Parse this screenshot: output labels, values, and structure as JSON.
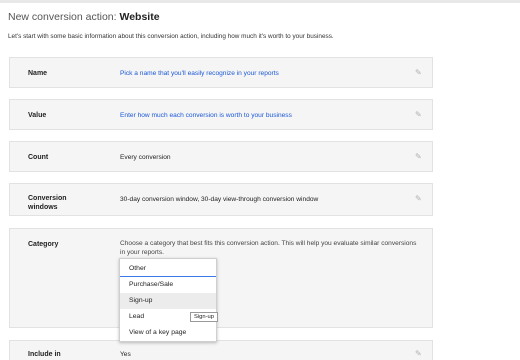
{
  "header": {
    "title_prefix": "New conversion action: ",
    "title_strong": "Website",
    "intro": "Let's start with some basic information about this conversion action, including how much it's worth to your business."
  },
  "rows": {
    "name": {
      "label": "Name",
      "value": "Pick a name that you'll easily recognize in your reports"
    },
    "value": {
      "label": "Value",
      "value": "Enter how much each conversion is worth to your business"
    },
    "count": {
      "label": "Count",
      "value": "Every conversion"
    },
    "windows": {
      "label_line1": "Conversion",
      "label_line2": "windows",
      "value": "30-day conversion window, 30-day view-through conversion window"
    },
    "category": {
      "label": "Category",
      "help": "Choose a category that best fits this conversion action. This will help you evaluate similar conversions in your reports."
    },
    "include": {
      "label_line1": "Include in",
      "value": "Yes"
    }
  },
  "category_dropdown": {
    "options": [
      "Other",
      "Purchase/Sale",
      "Sign-up",
      "Lead",
      "View of a key page"
    ],
    "selected": "Other",
    "hovered": "Sign-up"
  },
  "tooltip": "Sign-up",
  "icons": {
    "edit": "pencil-icon"
  },
  "colors": {
    "link": "#1a57d6",
    "selected_underline": "#3b78e7"
  }
}
